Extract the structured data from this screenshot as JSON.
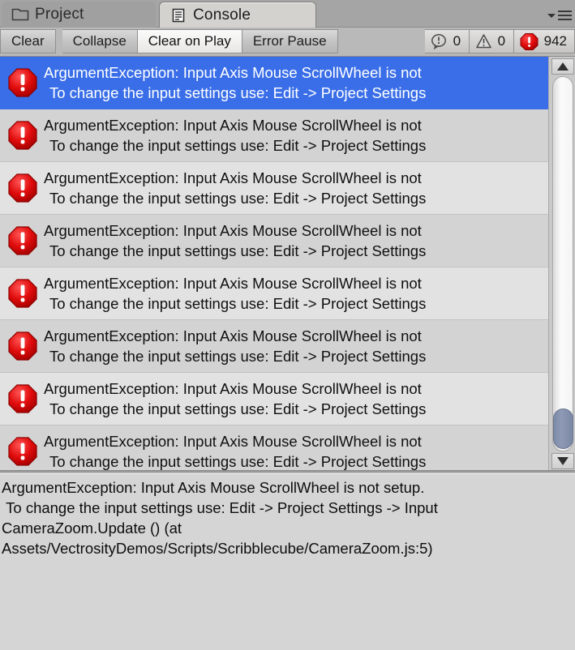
{
  "window": {
    "tabs": [
      {
        "label": "Project",
        "icon": "folder-icon",
        "active": false
      },
      {
        "label": "Console",
        "icon": "console-document-icon",
        "active": true
      }
    ],
    "menu_icon": "hamburger-menu-icon",
    "caret_icon": "chevron-down-icon"
  },
  "toolbar": {
    "clear_label": "Clear",
    "collapse_label": "Collapse",
    "clear_on_play_label": "Clear on Play",
    "error_pause_label": "Error Pause",
    "counters": {
      "info_icon": "info-bubble-icon",
      "info_count": "0",
      "warning_icon": "warning-triangle-icon",
      "warning_count": "0",
      "error_icon": "error-octagon-icon",
      "error_count": "942"
    }
  },
  "log": {
    "row_icon": "error-octagon-icon",
    "entries": [
      {
        "line1": "ArgumentException: Input Axis Mouse ScrollWheel is not",
        "line2": "To change the input settings use: Edit -> Project Settings",
        "selected": true
      },
      {
        "line1": "ArgumentException: Input Axis Mouse ScrollWheel is not",
        "line2": "To change the input settings use: Edit -> Project Settings",
        "selected": false
      },
      {
        "line1": "ArgumentException: Input Axis Mouse ScrollWheel is not",
        "line2": "To change the input settings use: Edit -> Project Settings",
        "selected": false
      },
      {
        "line1": "ArgumentException: Input Axis Mouse ScrollWheel is not",
        "line2": "To change the input settings use: Edit -> Project Settings",
        "selected": false
      },
      {
        "line1": "ArgumentException: Input Axis Mouse ScrollWheel is not",
        "line2": "To change the input settings use: Edit -> Project Settings",
        "selected": false
      },
      {
        "line1": "ArgumentException: Input Axis Mouse ScrollWheel is not",
        "line2": "To change the input settings use: Edit -> Project Settings",
        "selected": false
      },
      {
        "line1": "ArgumentException: Input Axis Mouse ScrollWheel is not",
        "line2": "To change the input settings use: Edit -> Project Settings",
        "selected": false
      },
      {
        "line1": "ArgumentException: Input Axis Mouse ScrollWheel is not",
        "line2": "To change the input settings use: Edit -> Project Settings",
        "selected": false
      }
    ]
  },
  "scrollbar": {
    "up_arrow_icon": "scroll-up-arrow-icon",
    "down_arrow_icon": "scroll-down-arrow-icon",
    "thumb_name": "vertical-scroll-thumb"
  },
  "detail": {
    "stack_trace": "ArgumentException: Input Axis Mouse ScrollWheel is not setup.\n To change the input settings use: Edit -> Project Settings -> Input\nCameraZoom.Update () (at Assets/VectrosityDemos/Scripts/Scribblecube/CameraZoom.js:5)"
  },
  "colors": {
    "selection_blue": "#3a6ee8",
    "error_red": "#d80b0b",
    "panel_gray": "#d5d5d5",
    "chrome_gray": "#b9b9b9"
  }
}
